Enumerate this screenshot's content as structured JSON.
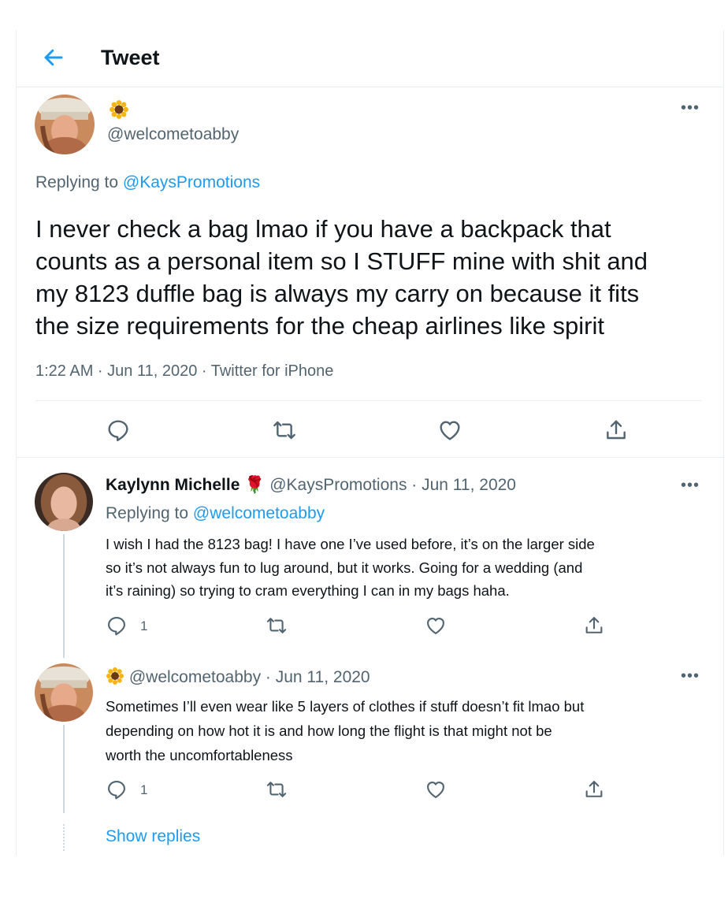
{
  "header": {
    "title": "Tweet"
  },
  "main_tweet": {
    "handle": "@welcometoabby",
    "reply_prefix": "Replying to",
    "reply_to": "@KaysPromotions",
    "text_lines": [
      "I never check a bag lmao if you have a backpack that",
      "counts as a personal item so I STUFF mine with shit and",
      "my 8123 duffle bag is always my carry on because it fits",
      "the size requirements for the cheap airlines like spirit"
    ],
    "meta": "1:22 AM · Jun 11, 2020 · Twitter for iPhone"
  },
  "reply1": {
    "name": "Kaylynn Michelle",
    "handle_date": "@KaysPromotions · Jun 11, 2020",
    "reply_prefix": "Replying to",
    "reply_to": "@welcometoabby",
    "text_lines": [
      "I wish I had the 8123 bag! I have one I’ve used before, it’s on the larger side",
      "so it’s not always fun to lug around, but it works. Going for a wedding (and",
      "it’s raining) so trying to cram everything I can in my bags haha."
    ],
    "reply_count": "1"
  },
  "reply2": {
    "handle_date": "@welcometoabby · Jun 11, 2020",
    "text_lines": [
      "Sometimes I’ll even wear like 5 layers of clothes if stuff doesn’t fit lmao but",
      "depending on how hot it is and how long the flight is that might not be",
      "worth the uncomfortableness"
    ],
    "reply_count": "1"
  },
  "show_replies": "Show replies",
  "colors": {
    "accent": "#1d9bf0",
    "text": "#0f1419",
    "muted": "#536471"
  },
  "icons": [
    "back-arrow-icon",
    "sunflower-emoji-icon",
    "more-icon",
    "reply-icon",
    "retweet-icon",
    "like-icon",
    "share-icon",
    "rose-emoji-icon"
  ]
}
